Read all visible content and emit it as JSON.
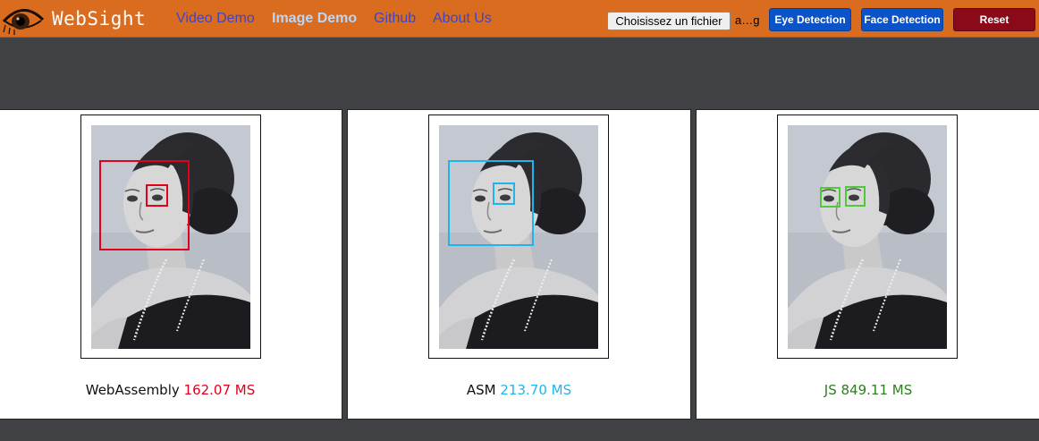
{
  "header": {
    "brand": "WebSight",
    "logo_icon": "eye-icon",
    "nav": [
      {
        "label": "Video Demo",
        "active": false
      },
      {
        "label": "Image Demo",
        "active": true
      },
      {
        "label": "Github",
        "active": false
      },
      {
        "label": "About Us",
        "active": false
      }
    ],
    "file_button_label": "Choisissez un fichier",
    "file_name": "a…g",
    "eye_detection_label": "Eye Detection",
    "face_detection_label": "Face Detection",
    "reset_label": "Reset"
  },
  "colors": {
    "navbar": "#d96c1f",
    "page_background": "#3f4145",
    "wasm": "#e3001b",
    "asm": "#1fb5ec",
    "js": "#4fc83a",
    "js_time_text": "#2e7d21"
  },
  "results": [
    {
      "engine": "WebAssembly",
      "time": "162.07 MS",
      "color": "#e3001b",
      "detection": "face-and-eye"
    },
    {
      "engine": "ASM",
      "time": "213.70 MS",
      "color": "#1fb5ec",
      "detection": "face-and-eye"
    },
    {
      "engine": "JS",
      "time": "849.11 MS",
      "color": "#2e7d21",
      "detection": "eyes"
    }
  ]
}
